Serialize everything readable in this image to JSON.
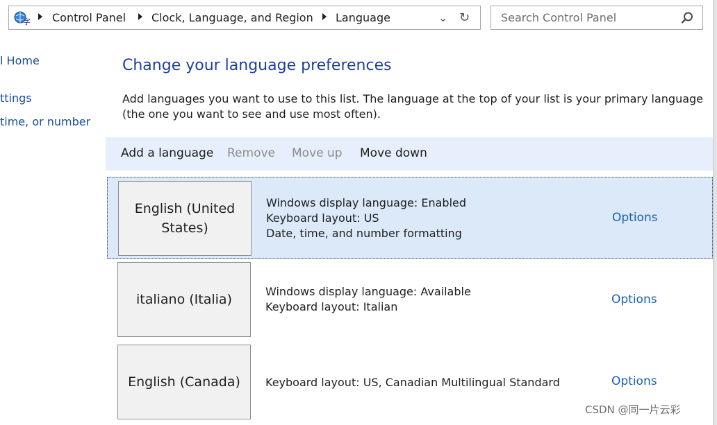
{
  "address_bar": {
    "breadcrumbs": [
      "Control Panel",
      "Clock, Language, and Region",
      "Language"
    ],
    "icon": "control-panel-language-icon",
    "dropdown_icon": "chevron-down-icon",
    "refresh_icon": "refresh-icon"
  },
  "search": {
    "placeholder": "Search Control Panel",
    "icon": "search-icon"
  },
  "sidebar": {
    "items": [
      {
        "label": "l Home"
      },
      {
        "label": "ttings"
      },
      {
        "label": " time, or number"
      }
    ]
  },
  "main": {
    "title": "Change your language preferences",
    "description": "Add languages you want to use to this list. The language at the top of your list is your primary language (the one you want to see and use most often)."
  },
  "toolbar": {
    "add": "Add a language",
    "remove": "Remove",
    "move_up": "Move up",
    "move_down": "Move down"
  },
  "languages": [
    {
      "name": "English (United States)",
      "details": [
        "Windows display language: Enabled",
        "Keyboard layout: US",
        "Date, time, and number formatting"
      ],
      "options": "Options",
      "selected": true
    },
    {
      "name": "italiano (Italia)",
      "details": [
        "Windows display language: Available",
        "Keyboard layout: Italian"
      ],
      "options": "Options",
      "selected": false
    },
    {
      "name": "English (Canada)",
      "details": [
        "Keyboard layout: US, Canadian Multilingual Standard"
      ],
      "options": "Options",
      "selected": false
    }
  ],
  "watermark": "CSDN @同一片云彩",
  "colors": {
    "title": "#1f3f9f",
    "link": "#1a5fb4",
    "toolbar_bg": "#e6effb",
    "selected_bg": "#dbe9f9"
  }
}
